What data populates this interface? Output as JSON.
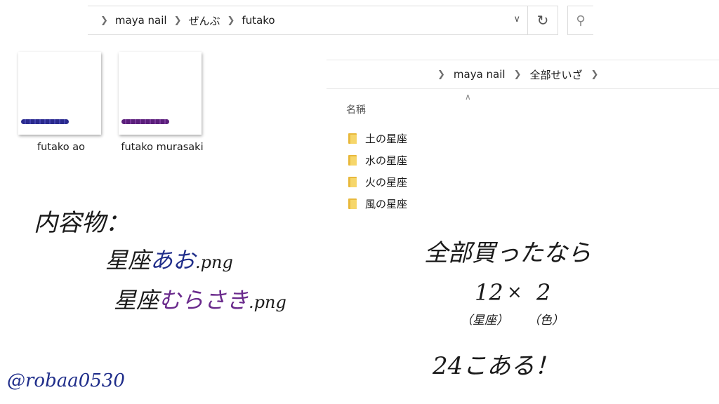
{
  "left_window": {
    "breadcrumbs": [
      "maya nail",
      "ぜんぶ",
      "futako"
    ],
    "files": [
      {
        "name": "futako ao",
        "bead_color": "#2a2a8c"
      },
      {
        "name": "futako murasaki",
        "bead_color": "#5a1f7a"
      }
    ]
  },
  "right_window": {
    "breadcrumbs": [
      "maya nail",
      "全部せいざ"
    ],
    "column_header": "名稱",
    "folders": [
      "土の星座",
      "水の星座",
      "火の星座",
      "風の星座"
    ]
  },
  "notes": {
    "contents_label": "内容物：",
    "file1_prefix": "星座",
    "file1_color_word": "あお",
    "file1_ext": ".png",
    "file2_prefix": "星座",
    "file2_color_word": "むらさき",
    "file2_ext": ".png",
    "buy_all": "全部買ったなら",
    "count_a": "12",
    "times": "×",
    "count_b": "2",
    "count_a_note": "（星座）",
    "count_b_note": "（色）",
    "result": "24こある！",
    "handle": "@robaa0530"
  },
  "colors": {
    "blue_word": "#1f2d8a",
    "purple_word": "#6a2a8c",
    "handle": "#1f2d8a"
  }
}
